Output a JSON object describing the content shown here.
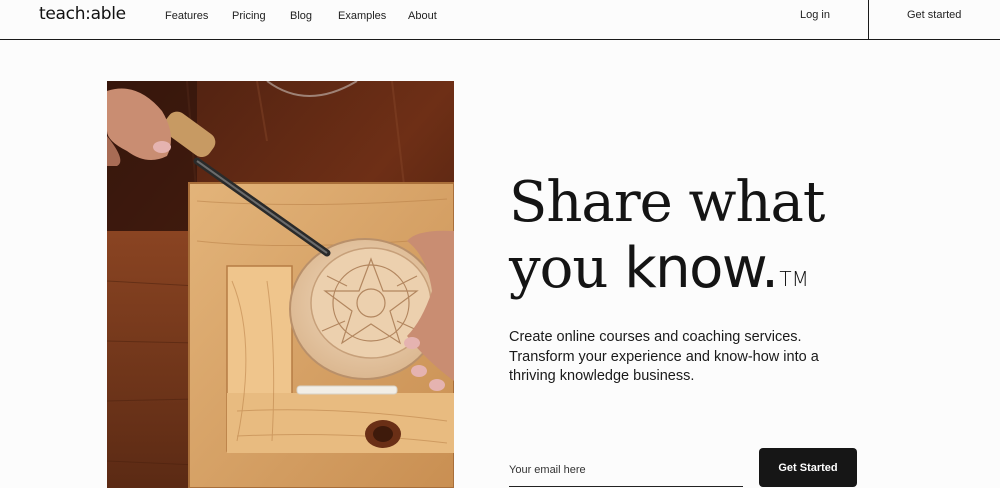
{
  "nav": {
    "logo": "teach:able",
    "links": [
      "Features",
      "Pricing",
      "Blog",
      "Examples",
      "About"
    ],
    "login": "Log in",
    "get_started": "Get started"
  },
  "hero": {
    "headline_line1": "Share what",
    "headline_line2_plain": "you ",
    "headline_line2_strong": "know.",
    "trademark": "TM",
    "subtitle": "Create online courses and coaching services. Transform your experience and know-how into a thriving knowledge business.",
    "email_placeholder": "Your email here",
    "cta_label": "Get Started"
  }
}
